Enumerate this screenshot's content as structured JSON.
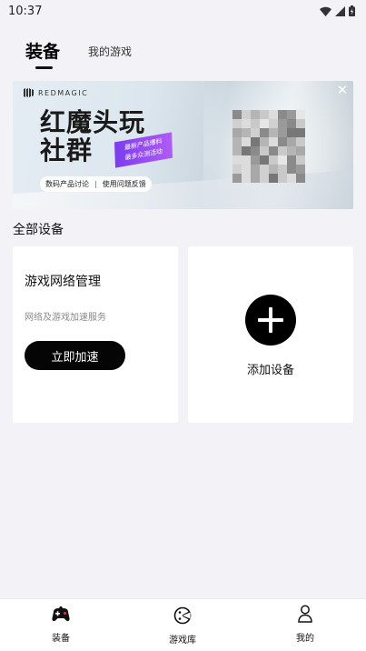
{
  "status_bar": {
    "time": "10:37"
  },
  "top_tabs": {
    "equipment": "装备",
    "my_games": "我的游戏"
  },
  "banner": {
    "logo_text": "REDMAGIC",
    "title_line1": "红魔头玩",
    "title_line2": "社群",
    "ribbon_line1": "最新产品爆料",
    "ribbon_line2": "最多众测活动",
    "pill_left": "数码产品讨论",
    "pill_sep": "|",
    "pill_right": "使用问题反馈"
  },
  "section": {
    "all_devices": "全部设备"
  },
  "network_card": {
    "title": "游戏网络管理",
    "subtitle": "网络及游戏加速服务",
    "button": "立即加速"
  },
  "add_card": {
    "label": "添加设备"
  },
  "bottom_nav": {
    "equipment": "装备",
    "game_library": "游戏库",
    "mine": "我的"
  },
  "colors": {
    "background": "#f3f2f6",
    "card": "#ffffff",
    "primary_black": "#050505",
    "ribbon_purple": "#8a45f2",
    "muted_text": "#8a8a8a"
  }
}
